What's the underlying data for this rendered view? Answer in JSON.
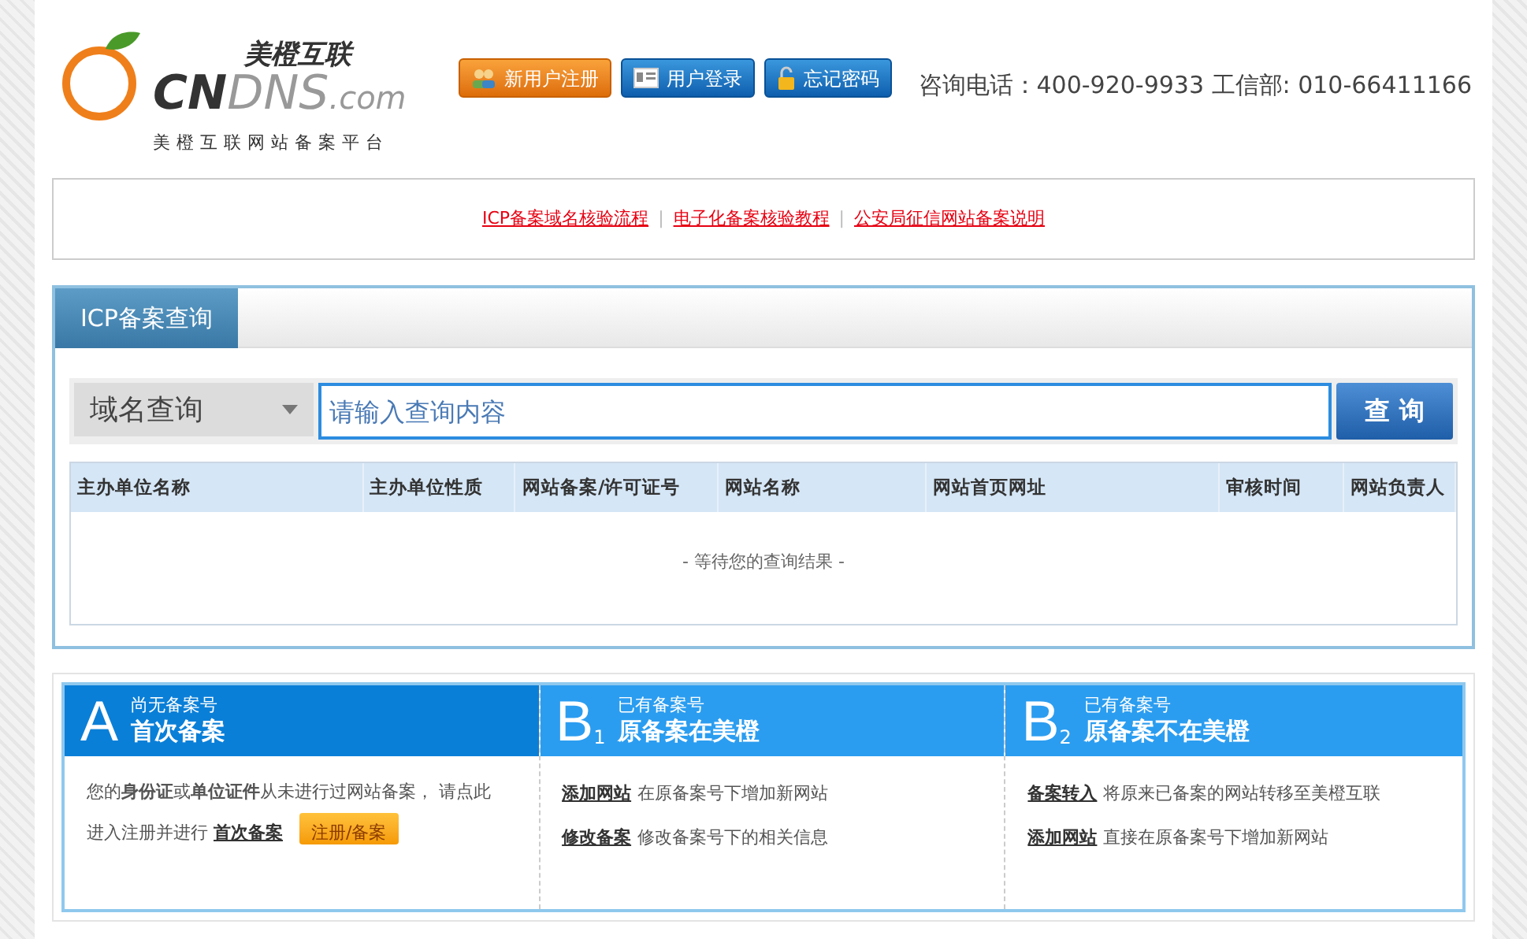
{
  "logo": {
    "brand_cn": "美橙互联",
    "brand_cn_top": "CN",
    "brand_en": "DNS",
    "brand_suffix": ".com",
    "tagline": "美橙互联网站备案平台"
  },
  "header_buttons": [
    {
      "kind": "register",
      "label": "新用户注册"
    },
    {
      "kind": "login",
      "label": "用户登录"
    },
    {
      "kind": "forgot",
      "label": "忘记密码"
    }
  ],
  "contact": "咨询电话：400-920-9933 工信部: 010-66411166",
  "links": [
    {
      "kind": "link",
      "text": "ICP备案域名核验流程"
    },
    {
      "kind": "separator",
      "text": "|"
    },
    {
      "kind": "link",
      "text": "电子化备案核验教程"
    },
    {
      "kind": "separator",
      "text": "|"
    },
    {
      "kind": "link",
      "text": "公安局征信网站备案说明"
    }
  ],
  "query_panel": {
    "tab": "ICP备案查询",
    "select": "域名查询",
    "placeholder": "请输入查询内容",
    "button": "查 询",
    "columns": [
      "主办单位名称",
      "主办单位性质",
      "网站备案/许可证号",
      "网站名称",
      "网站首页网址",
      "审核时间",
      "网站负责人"
    ],
    "empty_message": "- 等待您的查询结果 -"
  },
  "cards": [
    {
      "letter": "A",
      "kicker": "尚无备案号",
      "title": "首次备案",
      "color": "#0a7fd8",
      "text": "您的**身份证**或**单位证件**从未进行过网站备案， 请点此进入注册并进行",
      "link": "首次备案",
      "button": "注册/备案"
    },
    {
      "letter": "B",
      "sub": "1",
      "kicker": "已有备案号",
      "title": "原备案在美橙",
      "color": "#2b9df0",
      "actions": [
        {
          "link": "添加网站",
          "text": "在原备案号下增加新网站"
        },
        {
          "link": "修改备案",
          "text": "修改备案号下的相关信息"
        }
      ]
    },
    {
      "letter": "B",
      "sub": "2",
      "kicker": "已有备案号",
      "title": "原备案不在美橙",
      "color": "#2b9df0",
      "actions": [
        {
          "link": "备案转入",
          "text": "将原来已备案的网站转移至美橙互联"
        },
        {
          "link": "添加网站",
          "text": "直接在原备案号下增加新网站"
        }
      ]
    }
  ]
}
